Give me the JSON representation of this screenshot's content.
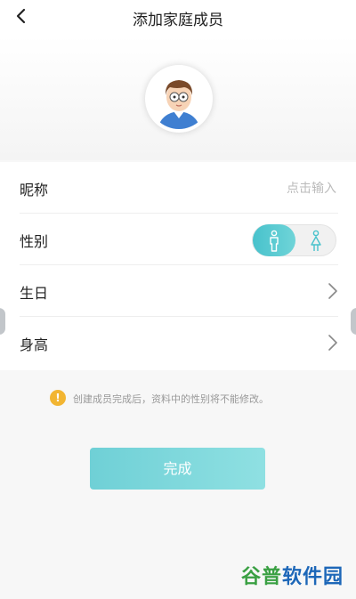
{
  "header": {
    "title": "添加家庭成员"
  },
  "avatar": {
    "name": "default-boy-avatar"
  },
  "form": {
    "nickname": {
      "label": "昵称",
      "placeholder": "点击输入"
    },
    "gender": {
      "label": "性别",
      "selected": "male",
      "options": [
        "male",
        "female"
      ]
    },
    "birthday": {
      "label": "生日"
    },
    "height": {
      "label": "身高"
    }
  },
  "notice": {
    "icon": "!",
    "text": "创建成员完成后，资料中的性别将不能修改。"
  },
  "actions": {
    "done_label": "完成"
  },
  "watermark": {
    "part1": "谷普",
    "part2": "软件园"
  },
  "colors": {
    "accent": "#48c2cc",
    "warning": "#f2b532",
    "watermark_green": "#3aa043",
    "watermark_blue": "#1d67b8"
  }
}
